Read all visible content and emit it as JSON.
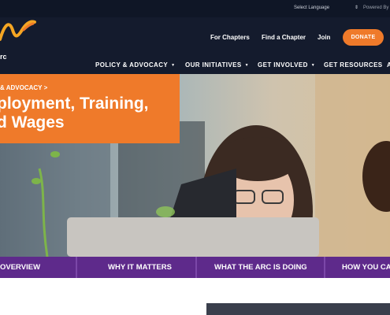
{
  "topbar": {
    "language": "Select Language",
    "powered_by": "Powered By"
  },
  "header": {
    "logo_text": "rc",
    "links": [
      "For Chapters",
      "Find a Chapter",
      "Join"
    ],
    "donate": "DONATE"
  },
  "nav": {
    "items": [
      "POLICY & ADVOCACY",
      "OUR INITIATIVES",
      "GET INVOLVED",
      "GET RESOURCES",
      "A"
    ]
  },
  "hero": {
    "breadcrumb": "& ADVOCACY",
    "breadcrumb_sep": ">",
    "title_line1": "ployment, Training,",
    "title_line2": "d Wages"
  },
  "tabs": [
    "OVERVIEW",
    "WHY IT MATTERS",
    "WHAT THE ARC IS DOING",
    "HOW YOU CA"
  ],
  "colors": {
    "orange": "#ef7a2a",
    "purple": "#5e2a8b",
    "navy": "#141b2d"
  }
}
